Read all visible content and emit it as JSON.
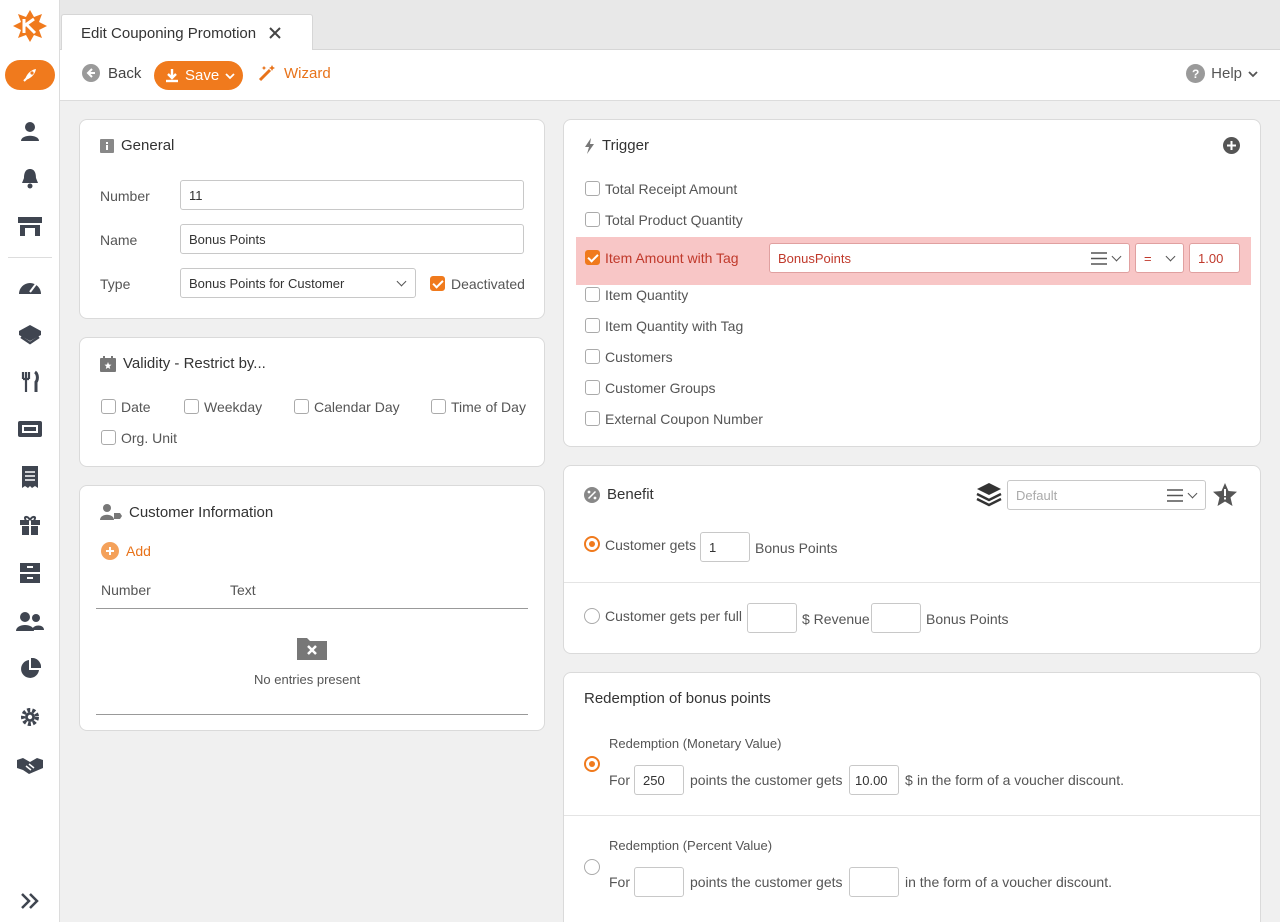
{
  "tab": {
    "title": "Edit Couponing Promotion"
  },
  "toolbar": {
    "back": "Back",
    "save": "Save",
    "wizard": "Wizard",
    "help": "Help"
  },
  "sidebar": {
    "icons": [
      "user-icon",
      "bell-icon",
      "store-icon",
      "dashboard-icon",
      "handshake-box-icon",
      "cutlery-icon",
      "ticket-icon",
      "receipt-icon",
      "gift-icon",
      "archive-icon",
      "users-icon",
      "pie-chart-icon",
      "gear-icon",
      "handshake-icon",
      "expand-icon"
    ]
  },
  "general": {
    "title": "General",
    "number_label": "Number",
    "number_value": "11",
    "name_label": "Name",
    "name_value": "Bonus Points",
    "type_label": "Type",
    "type_value": "Bonus Points for Customer",
    "deactivated_label": "Deactivated",
    "deactivated_checked": true
  },
  "validity": {
    "title": "Validity - Restrict by...",
    "options": [
      "Date",
      "Weekday",
      "Calendar Day",
      "Time of Day",
      "Org. Unit"
    ]
  },
  "customer_info": {
    "title": "Customer Information",
    "add_label": "Add",
    "columns": [
      "Number",
      "Text"
    ],
    "empty_text": "No entries present"
  },
  "trigger": {
    "title": "Trigger",
    "items": [
      {
        "label": "Total Receipt Amount",
        "checked": false
      },
      {
        "label": "Total Product Quantity",
        "checked": false
      },
      {
        "label": "Item Amount with Tag",
        "checked": true
      },
      {
        "label": "Item Quantity",
        "checked": false
      },
      {
        "label": "Item Quantity with Tag",
        "checked": false
      },
      {
        "label": "Customers",
        "checked": false
      },
      {
        "label": "Customer Groups",
        "checked": false
      },
      {
        "label": "External Coupon Number",
        "checked": false
      }
    ],
    "tag_value": "BonusPoints",
    "operator": "=",
    "amount": "1.00",
    "highlight_color": "#f8c6c6"
  },
  "benefit": {
    "title": "Benefit",
    "default_placeholder": "Default",
    "opt1_prefix": "Customer gets",
    "opt1_value": "1",
    "opt1_suffix": "Bonus Points",
    "opt2_prefix": "Customer gets per full",
    "opt2_mid": "$ Revenue",
    "opt2_suffix": "Bonus Points"
  },
  "redemption": {
    "title": "Redemption of bonus points",
    "monetary": {
      "title": "Redemption (Monetary Value)",
      "for": "For",
      "points_value": "250",
      "mid": "points the customer gets",
      "value": "10.00",
      "unit": "$",
      "suffix": "in the form of a voucher discount."
    },
    "percent": {
      "title": "Redemption (Percent Value)",
      "for": "For",
      "mid": "points the customer gets",
      "suffix": "in the form of a voucher discount."
    }
  },
  "colors": {
    "accent": "#f07a1d"
  }
}
